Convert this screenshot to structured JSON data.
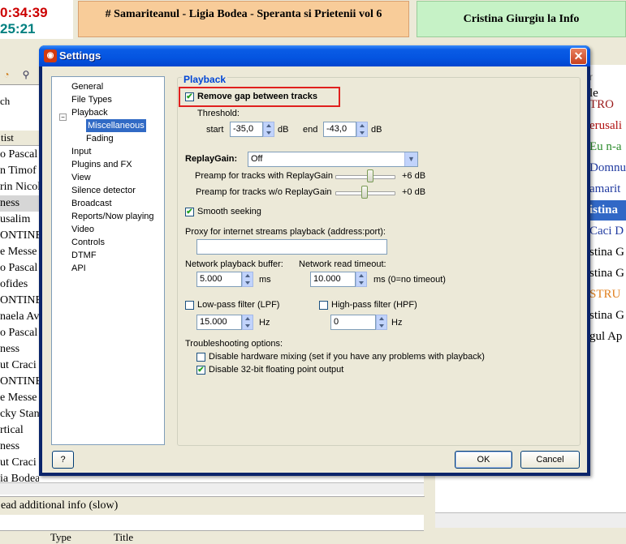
{
  "background": {
    "timer_elapsed": "0:34:39",
    "timer_remaining": "25:21",
    "now_playing": "# Samariteanul - Ligia Bodea - Speranta si Prietenii vol 6",
    "next_playing": "Cristina Giurgiu la Info",
    "left_search_label": "ch",
    "left_col_header": "tist",
    "left_rows": [
      "o Pascal",
      "n Timof",
      "rin Nicol",
      "ness",
      "usalim",
      "ONTINE",
      "e Messe",
      "o Pascal",
      "ofides",
      "ONTINE",
      "naela Av",
      "o Pascal",
      "ness",
      "ut Craci",
      "ONTINE",
      "e Messe",
      "cky Stan",
      "rtical",
      "ness",
      "ut Craci",
      "ia Bodea"
    ],
    "left_status": "ead additional info (slow)",
    "bottom_col_type": "Type",
    "bottom_col_title": "Title",
    "right_header": "r",
    "right_col_header": "le",
    "right_rows": [
      {
        "text": "TRO",
        "color": "#9a1a1a"
      },
      {
        "text": "erusali",
        "color": "#b01010"
      },
      {
        "text": "Eu n-a",
        "color": "#2a8a2a"
      },
      {
        "text": "Domnu",
        "color": "#203aa0"
      },
      {
        "text": "amarit",
        "color": "#203aa0"
      },
      {
        "text": "istina",
        "color": "#ffffff"
      },
      {
        "text": "Caci D",
        "color": "#203aa0"
      },
      {
        "text": "stina G",
        "color": "#000000"
      },
      {
        "text": "stina G",
        "color": "#000000"
      },
      {
        "text": "STRU",
        "color": "#e08020"
      },
      {
        "text": "stina G",
        "color": "#000000"
      },
      {
        "text": "gul Ap",
        "color": "#000000"
      }
    ]
  },
  "dialog": {
    "title": "Settings",
    "close_glyph": "✕",
    "tree": [
      {
        "label": "General",
        "level": 1,
        "selected": false
      },
      {
        "label": "File Types",
        "level": 1,
        "selected": false
      },
      {
        "label": "Playback",
        "level": 1,
        "selected": false,
        "expanded": true
      },
      {
        "label": "Miscellaneous",
        "level": 2,
        "selected": true
      },
      {
        "label": "Fading",
        "level": 2,
        "selected": false
      },
      {
        "label": "Input",
        "level": 1,
        "selected": false
      },
      {
        "label": "Plugins and FX",
        "level": 1,
        "selected": false
      },
      {
        "label": "View",
        "level": 1,
        "selected": false
      },
      {
        "label": "Silence detector",
        "level": 1,
        "selected": false
      },
      {
        "label": "Broadcast",
        "level": 1,
        "selected": false
      },
      {
        "label": "Reports/Now playing",
        "level": 1,
        "selected": false
      },
      {
        "label": "Video",
        "level": 1,
        "selected": false
      },
      {
        "label": "Controls",
        "level": 1,
        "selected": false
      },
      {
        "label": "DTMF",
        "level": 1,
        "selected": false
      },
      {
        "label": "API",
        "level": 1,
        "selected": false
      }
    ],
    "group_title": "Playback",
    "remove_gap": {
      "label": "Remove gap between tracks",
      "checked": true
    },
    "threshold": {
      "label": "Threshold:",
      "start_label": "start",
      "start_value": "-35,0",
      "start_unit": "dB",
      "end_label": "end",
      "end_value": "-43,0",
      "end_unit": "dB"
    },
    "replaygain": {
      "label": "ReplayGain:",
      "value": "Off",
      "preamp_with_label": "Preamp for tracks with ReplayGain",
      "preamp_with_value": "+6 dB",
      "preamp_with_level": 0.6,
      "preamp_without_label": "Preamp for tracks w/o ReplayGain",
      "preamp_without_value": "+0 dB",
      "preamp_without_level": 0.5
    },
    "smooth_seeking": {
      "label": "Smooth seeking",
      "checked": true
    },
    "proxy": {
      "label": "Proxy for internet streams playback (address:port):",
      "value": ""
    },
    "network_buffer": {
      "label": "Network playback buffer:",
      "value": "5.000",
      "unit": "ms"
    },
    "network_timeout": {
      "label": "Network read timeout:",
      "value": "10.000",
      "unit": "ms (0=no timeout)"
    },
    "lpf": {
      "label": "Low-pass filter (LPF)",
      "checked": false,
      "value": "15.000",
      "unit": "Hz"
    },
    "hpf": {
      "label": "High-pass filter (HPF)",
      "checked": false,
      "value": "0",
      "unit": "Hz"
    },
    "troubleshooting": {
      "label": "Troubleshooting options:",
      "disable_hw": {
        "label": "Disable hardware mixing (set if you have any problems with playback)",
        "checked": false
      },
      "disable_float": {
        "label": "Disable 32-bit floating point output",
        "checked": true
      }
    },
    "help_label": "?",
    "ok_label": "OK",
    "cancel_label": "Cancel"
  }
}
